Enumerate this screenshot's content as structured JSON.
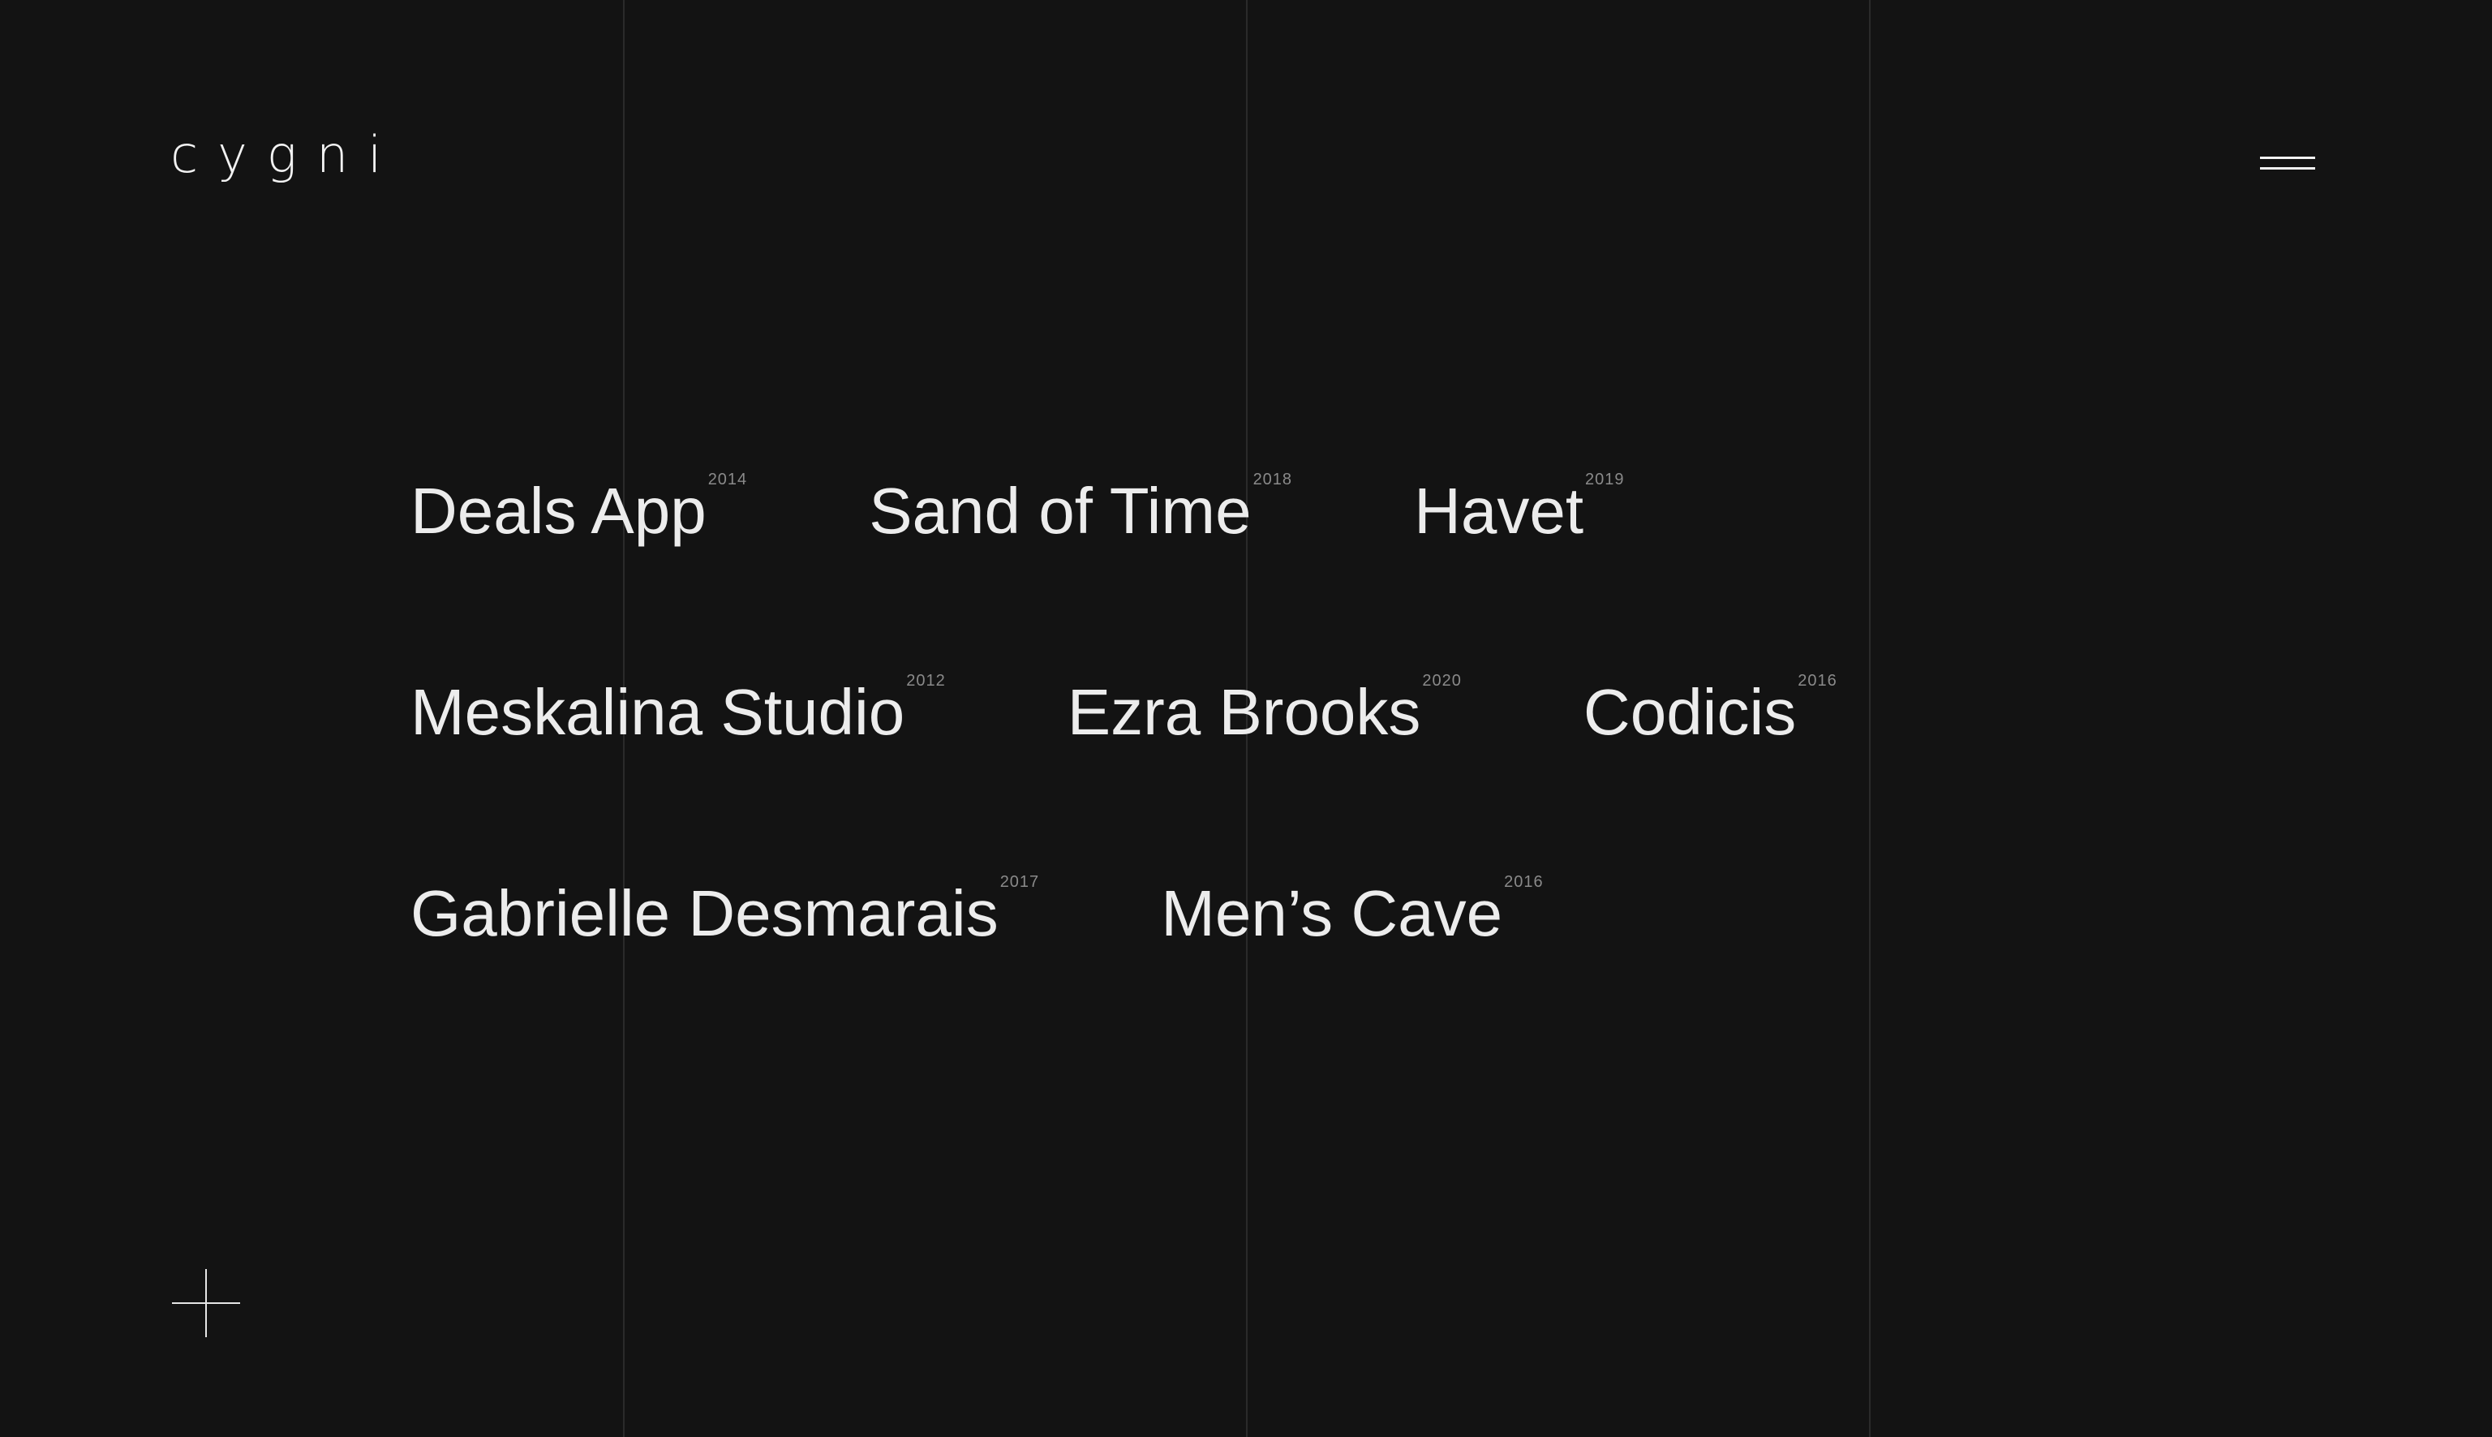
{
  "brand": {
    "logo": "cygni"
  },
  "projects": [
    [
      {
        "name": "Deals App",
        "year": "2014"
      },
      {
        "name": "Sand of Time",
        "year": "2018"
      },
      {
        "name": "Havet",
        "year": "2019"
      }
    ],
    [
      {
        "name": "Meskalina Studio",
        "year": "2012"
      },
      {
        "name": "Ezra Brooks",
        "year": "2020"
      },
      {
        "name": "Codicis",
        "year": "2016"
      }
    ],
    [
      {
        "name": "Gabrielle Desmarais",
        "year": "2017"
      },
      {
        "name": "Men’s Cave",
        "year": "2016"
      }
    ]
  ],
  "icons": {
    "menu": "hamburger-menu-icon",
    "plus": "plus-icon"
  },
  "colors": {
    "background": "#131313",
    "text": "#ececec",
    "year": "#8a8a8a",
    "grid_line": "#2b2b2b"
  }
}
